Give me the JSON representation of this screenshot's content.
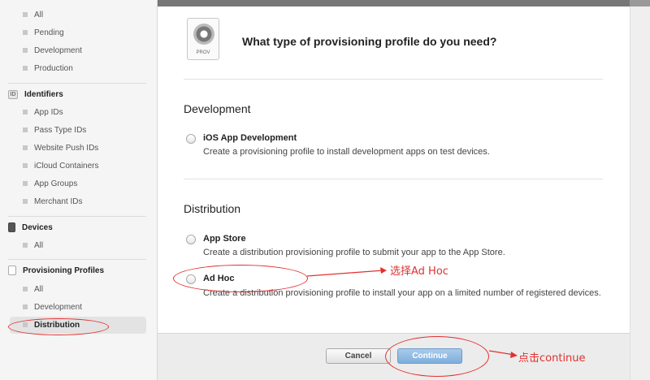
{
  "sidebar": {
    "certificates_items": [
      "All",
      "Pending",
      "Development",
      "Production"
    ],
    "identifiers": {
      "header": "Identifiers",
      "icon_text": "ID",
      "items": [
        "App IDs",
        "Pass Type IDs",
        "Website Push IDs",
        "iCloud Containers",
        "App Groups",
        "Merchant IDs"
      ]
    },
    "devices": {
      "header": "Devices",
      "items": [
        "All"
      ]
    },
    "provisioning": {
      "header": "Provisioning Profiles",
      "items": [
        "All",
        "Development",
        "Distribution"
      ],
      "selected": "Distribution"
    }
  },
  "main": {
    "prov_icon_label": "PROV",
    "question": "What type of provisioning profile do you need?",
    "development": {
      "title": "Development",
      "options": [
        {
          "title": "iOS App Development",
          "desc": "Create a provisioning profile to install development apps on test devices."
        }
      ]
    },
    "distribution": {
      "title": "Distribution",
      "options": [
        {
          "title": "App Store",
          "desc": "Create a distribution provisioning profile to submit your app to the App Store."
        },
        {
          "title": "Ad Hoc",
          "desc": "Create a distribution provisioning profile to install your app on a limited number of registered devices."
        }
      ]
    }
  },
  "footer": {
    "cancel_label": "Cancel",
    "continue_label": "Continue"
  },
  "annotations": {
    "select_adhoc": "选择Ad Hoc",
    "click_continue": "点击continue"
  },
  "colors": {
    "annotation": "#e23030",
    "primary_button": "#7eaedd"
  }
}
